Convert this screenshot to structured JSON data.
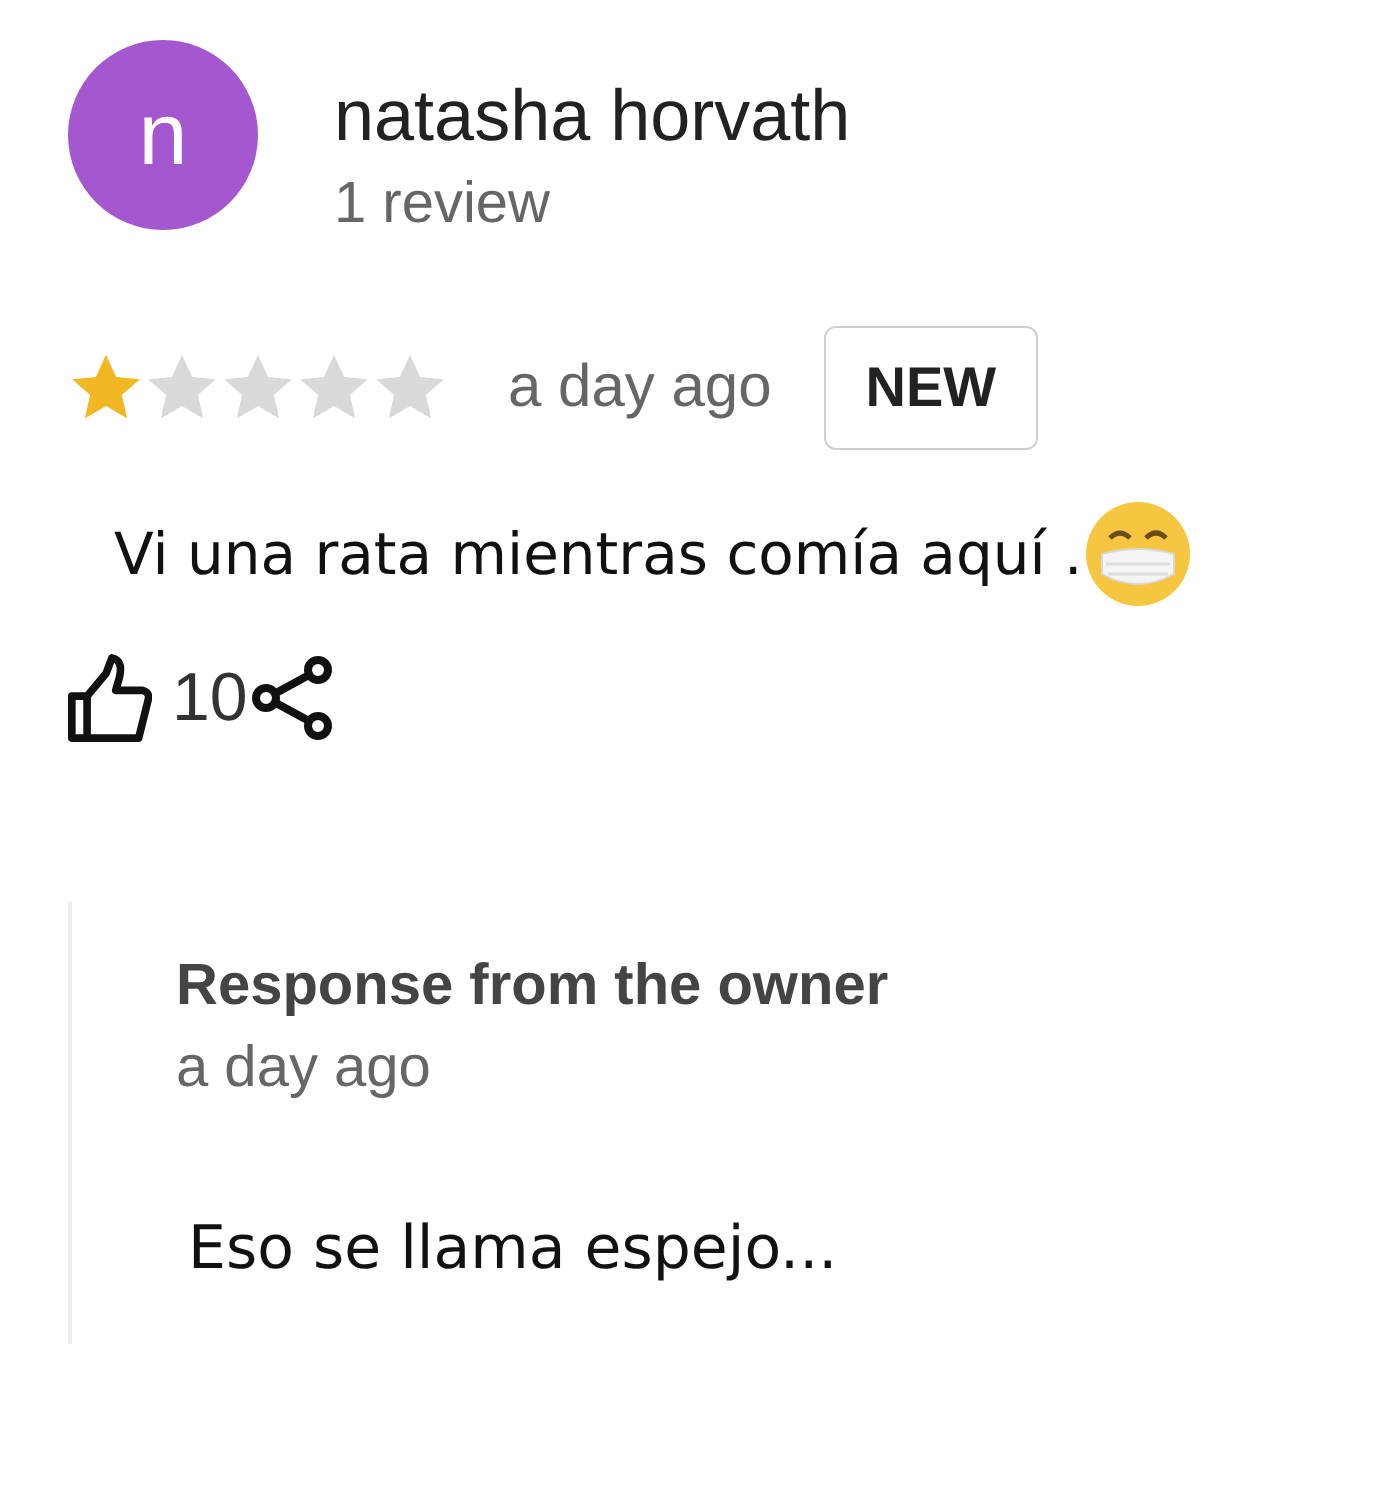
{
  "review": {
    "avatar_letter": "n",
    "author": "natasha horvath",
    "review_count": "1 review",
    "stars": 1,
    "time": "a day ago",
    "badge": "NEW",
    "text": "Vi una rata mientras comía aquí .",
    "likes": "10"
  },
  "owner_response": {
    "heading": "Response from the owner",
    "time": "a day ago",
    "text": "Eso se llama espejo..."
  }
}
